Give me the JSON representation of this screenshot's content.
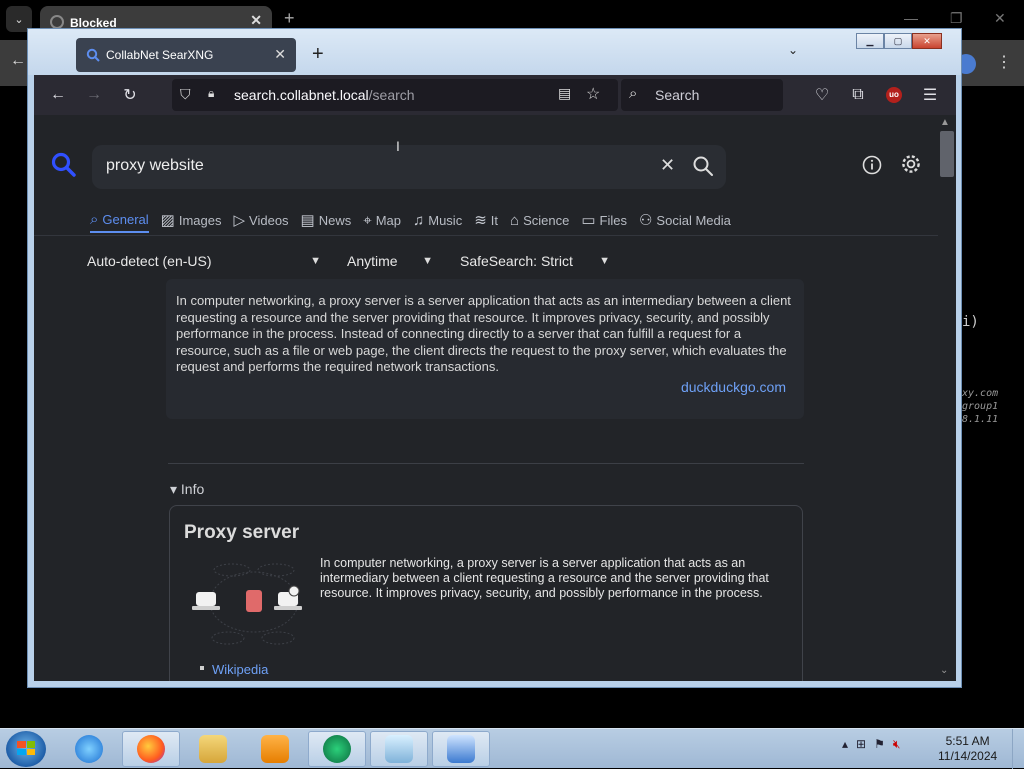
{
  "background_browser": {
    "tab_title": "Blocked",
    "side_text": [
      "i)",
      "xy.com",
      "group1",
      "8.1.11"
    ]
  },
  "firefox": {
    "tab_title": "CollabNet SearXNG",
    "url_host": "search.collabnet.local",
    "url_path": "/search",
    "search_placeholder": "Search"
  },
  "searxng": {
    "query": "proxy website",
    "tabs": [
      {
        "label": "General",
        "icon": "search-icon",
        "active": true
      },
      {
        "label": "Images",
        "icon": "image-icon"
      },
      {
        "label": "Videos",
        "icon": "play-icon"
      },
      {
        "label": "News",
        "icon": "newspaper-icon"
      },
      {
        "label": "Map",
        "icon": "map-pin-icon"
      },
      {
        "label": "Music",
        "icon": "music-icon"
      },
      {
        "label": "It",
        "icon": "layers-icon"
      },
      {
        "label": "Science",
        "icon": "graduation-cap-icon"
      },
      {
        "label": "Files",
        "icon": "files-icon"
      },
      {
        "label": "Social Media",
        "icon": "people-icon"
      }
    ],
    "filters": {
      "language": "Auto-detect (en-US)",
      "time": "Anytime",
      "safesearch": "SafeSearch: Strict"
    },
    "answer": {
      "text": "In computer networking, a proxy server is a server application that acts as an intermediary between a client requesting a resource and the server providing that resource. It improves privacy, security, and possibly performance in the process. Instead of connecting directly to a server that can fulfill a request for a resource, such as a file or web page, the client directs the request to the proxy server, which evaluates the request and performs the required network transactions.",
      "source": "duckduckgo.com"
    },
    "info_label": "▾ Info",
    "infobox": {
      "title": "Proxy server",
      "description": "In computer networking, a proxy server is a server application that acts as an intermediary between a client requesting a resource and the server providing that resource. It improves privacy, security, and possibly performance in the process.",
      "link": "Wikipedia"
    }
  },
  "taskbar": {
    "time": "5:51 AM",
    "date": "11/14/2024"
  },
  "colors": {
    "accent": "#5d8ef0",
    "link": "#6ea0f5",
    "page_bg": "#222428"
  }
}
